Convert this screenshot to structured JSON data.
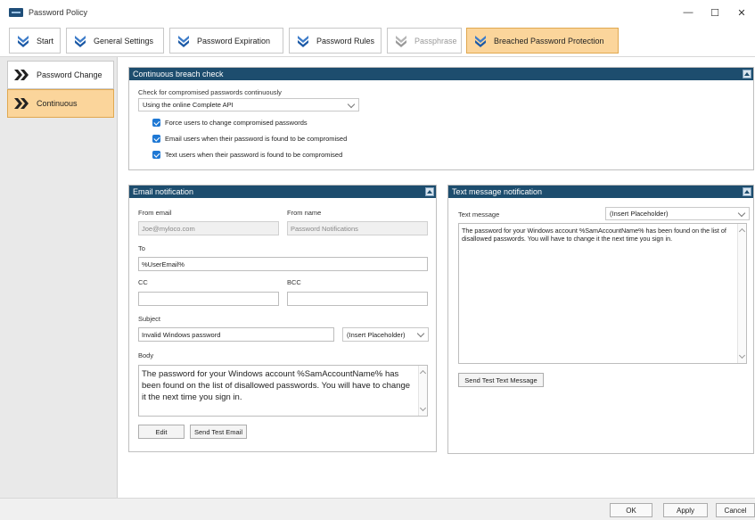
{
  "window": {
    "title": "Password Policy",
    "minimize": "—",
    "maximize": "☐",
    "close": "✕"
  },
  "tabs": [
    {
      "label": "Start"
    },
    {
      "label": "General Settings"
    },
    {
      "label": "Password Expiration"
    },
    {
      "label": "Password Rules"
    },
    {
      "label": "Passphrase"
    },
    {
      "label": "Breached Password Protection"
    }
  ],
  "nav": [
    {
      "label": "Password Change"
    },
    {
      "label": "Continuous"
    }
  ],
  "breach": {
    "title": "Continuous breach check",
    "check_label": "Check for compromised passwords continuously",
    "api_value": "Using the online Complete API",
    "options": [
      "Force users to change compromised passwords",
      "Email users when their password is found to be compromised",
      "Text users when their password is found to be compromised"
    ]
  },
  "email": {
    "title": "Email notification",
    "from_email_label": "From email",
    "from_email_value": "Joe@myloco.com",
    "from_name_label": "From name",
    "from_name_value": "Password Notifications",
    "to_label": "To",
    "to_value": "%UserEmail%",
    "cc_label": "CC",
    "bcc_label": "BCC",
    "subject_label": "Subject",
    "subject_value": "Invalid Windows password",
    "placeholder_select": "(Insert Placeholder)",
    "body_label": "Body",
    "body_value": "The password for your Windows account %SamAccountName% has been found on the list of disallowed passwords. You will have to change it the next time you sign in.",
    "edit_button": "Edit",
    "send_test_button": "Send Test Email"
  },
  "sms": {
    "title": "Text message notification",
    "message_label": "Text message",
    "placeholder_select": "(Insert Placeholder)",
    "message_value": "The password for your Windows account %SamAccountName% has been found on the list of disallowed passwords. You will have to change it the next time you sign in.",
    "send_test_button": "Send Test Text Message"
  },
  "footer": {
    "ok": "OK",
    "apply": "Apply",
    "cancel": "Cancel"
  },
  "colors": {
    "panel_header": "#1d4d6e",
    "active_tab": "#fbd59b",
    "checkbox": "#1e78d4"
  }
}
